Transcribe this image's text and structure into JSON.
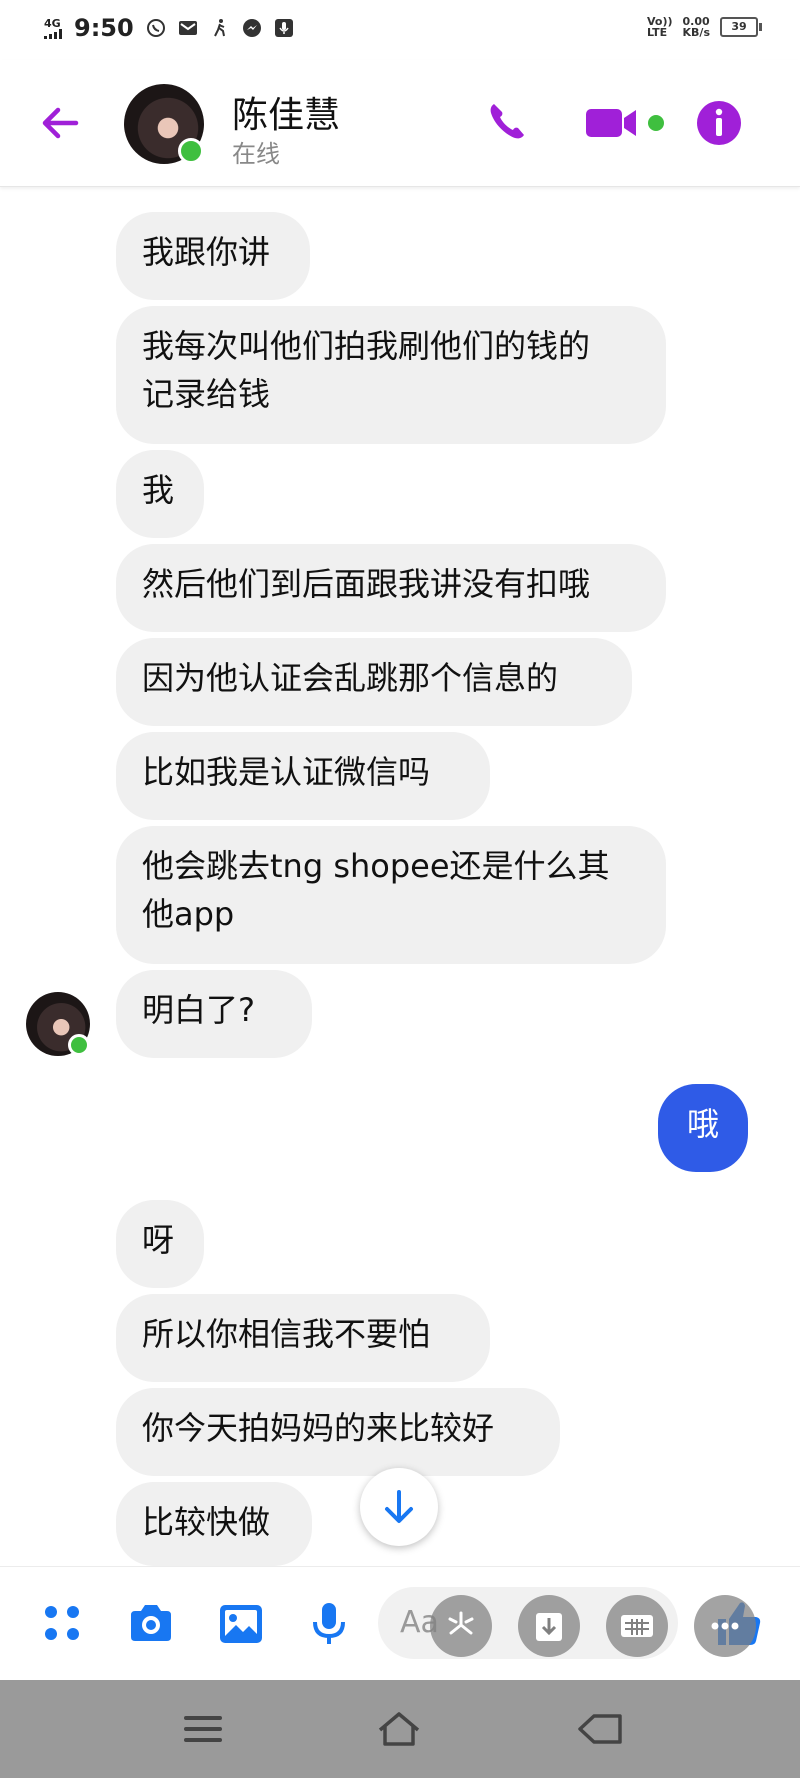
{
  "status_bar": {
    "network_type": "4G",
    "time": "9:50",
    "volte": "Vo))",
    "lte": "LTE",
    "speed_value": "0.00",
    "speed_unit": "KB/s",
    "battery": "39"
  },
  "header": {
    "contact_name": "陈佳慧",
    "contact_status": "在线"
  },
  "messages": [
    {
      "sender": "them",
      "text": "我跟你讲"
    },
    {
      "sender": "them",
      "text": "我每次叫他们拍我刷他们的钱的\n记录给钱"
    },
    {
      "sender": "them",
      "text": "我"
    },
    {
      "sender": "them",
      "text": "然后他们到后面跟我讲没有扣哦"
    },
    {
      "sender": "them",
      "text": "因为他认证会乱跳那个信息的"
    },
    {
      "sender": "them",
      "text": "比如我是认证微信吗"
    },
    {
      "sender": "them",
      "text": "他会跳去tng shopee还是什么其\n他app"
    },
    {
      "sender": "them",
      "text": "明白了?"
    },
    {
      "sender": "me",
      "text": "哦"
    },
    {
      "sender": "them",
      "text": "呀"
    },
    {
      "sender": "them",
      "text": "所以你相信我不要怕"
    },
    {
      "sender": "them",
      "text": "你今天拍妈妈的来比较好"
    },
    {
      "sender": "them",
      "text": "比较快做"
    }
  ],
  "composer": {
    "placeholder": "Aa"
  },
  "colors": {
    "accent": "#a020d8",
    "my_bubble": "#2f5be7",
    "their_bubble": "#f0f0f0",
    "online": "#3fbf3f",
    "composer_icon": "#1877f2"
  },
  "icons": {
    "back": "arrow-left",
    "call": "phone",
    "video": "video-camera",
    "info": "info-circle",
    "menu": "grid-dots",
    "camera": "camera",
    "gallery": "image",
    "mic": "microphone",
    "like": "thumbs-up"
  }
}
